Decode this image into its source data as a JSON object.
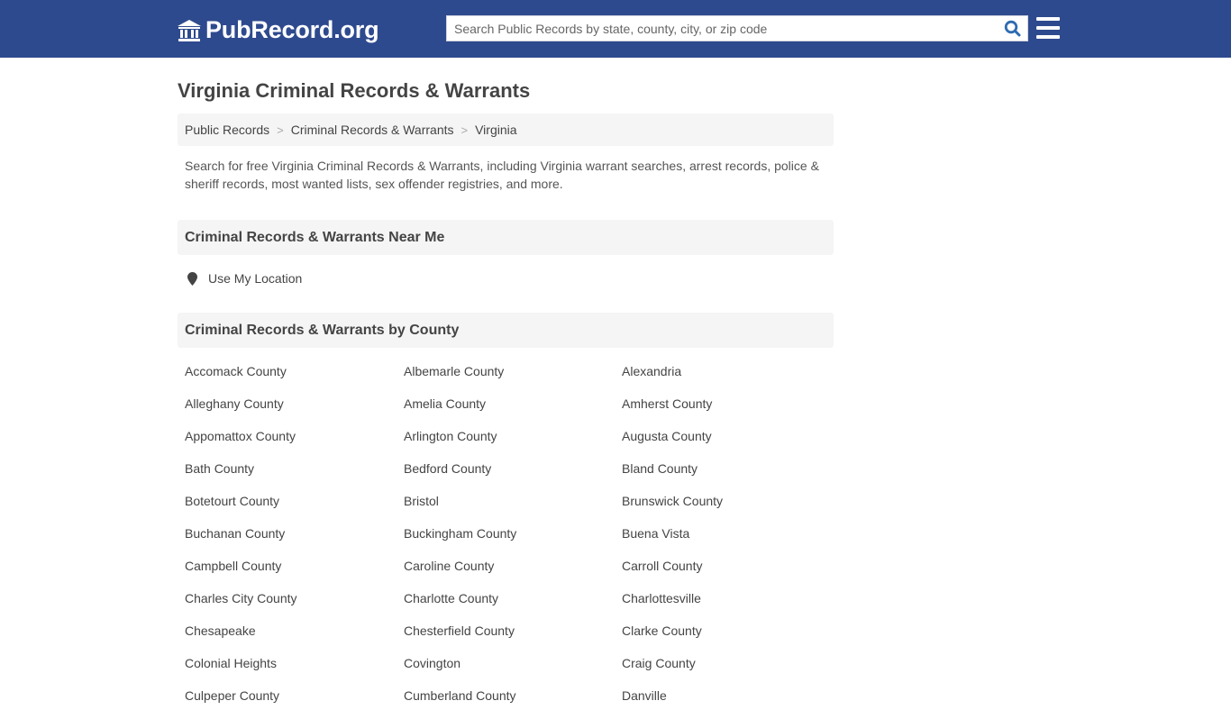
{
  "header": {
    "logo_text": "PubRecord.org",
    "search_placeholder": "Search Public Records by state, county, city, or zip code",
    "colors": {
      "bar": "#2e4a8e",
      "search_icon": "#2e6bb0"
    }
  },
  "page": {
    "title": "Virginia Criminal Records & Warrants",
    "breadcrumb": [
      {
        "label": "Public Records"
      },
      {
        "label": "Criminal Records & Warrants"
      },
      {
        "label": "Virginia"
      }
    ],
    "breadcrumb_separator": ">",
    "intro": "Search for free Virginia Criminal Records & Warrants, including Virginia warrant searches, arrest records, police & sheriff records, most wanted lists, sex offender registries, and more."
  },
  "near_me": {
    "heading": "Criminal Records & Warrants Near Me",
    "location_label": "Use My Location"
  },
  "by_county": {
    "heading": "Criminal Records & Warrants by County",
    "counties": [
      "Accomack County",
      "Albemarle County",
      "Alexandria",
      "Alleghany County",
      "Amelia County",
      "Amherst County",
      "Appomattox County",
      "Arlington County",
      "Augusta County",
      "Bath County",
      "Bedford County",
      "Bland County",
      "Botetourt County",
      "Bristol",
      "Brunswick County",
      "Buchanan County",
      "Buckingham County",
      "Buena Vista",
      "Campbell County",
      "Caroline County",
      "Carroll County",
      "Charles City County",
      "Charlotte County",
      "Charlottesville",
      "Chesapeake",
      "Chesterfield County",
      "Clarke County",
      "Colonial Heights",
      "Covington",
      "Craig County",
      "Culpeper County",
      "Cumberland County",
      "Danville"
    ]
  }
}
